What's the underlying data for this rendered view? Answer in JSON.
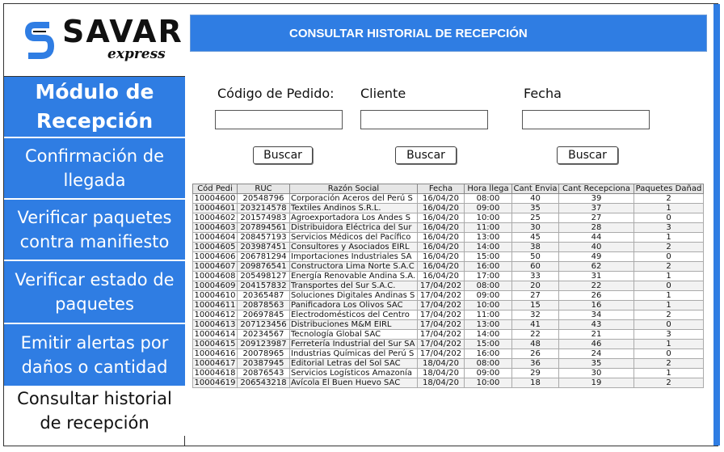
{
  "brand": {
    "name": "SAVAR",
    "tagline": "express",
    "primary_color": "#2f7de3",
    "logo_icon": "savar-s-logo-icon"
  },
  "sidebar": {
    "title": "Módulo de Recepción",
    "items": [
      {
        "label": "Confirmación de llegada"
      },
      {
        "label": "Verificar paquetes contra manifiesto"
      },
      {
        "label": "Verificar estado de paquetes"
      },
      {
        "label": "Emitir alertas por daños o cantidad"
      },
      {
        "label": "Consultar historial de recepción",
        "active": true
      }
    ]
  },
  "header": {
    "title": "CONSULTAR HISTORIAL DE RECEPCIÓN"
  },
  "filters": {
    "codigo_label": "Código de Pedido:",
    "cliente_label": "Cliente",
    "fecha_label": "Fecha",
    "codigo_value": "",
    "cliente_value": "",
    "fecha_value": "",
    "button_label": "Buscar"
  },
  "table": {
    "columns": [
      "Cód Pedi",
      "RUC",
      "Razón Social",
      "Fecha",
      "Hora llega",
      "Cant Envia",
      "Cant Recepciona",
      "Paquetes Dañad"
    ],
    "rows": [
      [
        "10004600",
        "20548796",
        "Corporación Aceros del Perú S",
        "16/04/20",
        "08:00",
        "40",
        "39",
        "2"
      ],
      [
        "10004601",
        "203214578",
        "Textiles Andinos S.R.L.",
        "16/04/20",
        "09:00",
        "35",
        "37",
        "1"
      ],
      [
        "10004602",
        "201574983",
        "Agroexportadora Los Andes S",
        "16/04/20",
        "10:00",
        "25",
        "27",
        "0"
      ],
      [
        "10004603",
        "207894561",
        "Distribuidora Eléctrica del Sur",
        "16/04/20",
        "11:00",
        "30",
        "28",
        "3"
      ],
      [
        "10004604",
        "208457193",
        "Servicios Médicos del Pacífico",
        "16/04/20",
        "13:00",
        "45",
        "44",
        "1"
      ],
      [
        "10004605",
        "203987451",
        "Consultores y Asociados EIRL",
        "16/04/20",
        "14:00",
        "38",
        "40",
        "2"
      ],
      [
        "10004606",
        "206781294",
        "Importaciones Industriales SA",
        "16/04/20",
        "15:00",
        "50",
        "49",
        "0"
      ],
      [
        "10004607",
        "209876541",
        "Constructora Lima Norte S.A.C",
        "16/04/20",
        "16:00",
        "60",
        "62",
        "2"
      ],
      [
        "10004608",
        "205498127",
        "Energía Renovable Andina S.A.",
        "16/04/20",
        "17:00",
        "33",
        "31",
        "1"
      ],
      [
        "10004609",
        "204157832",
        "Transportes del Sur S.A.C.",
        "17/04/202",
        "08:00",
        "20",
        "22",
        "0"
      ],
      [
        "10004610",
        "20365487",
        "Soluciones Digitales Andinas S",
        "17/04/202",
        "09:00",
        "27",
        "26",
        "1"
      ],
      [
        "10004611",
        "20878563",
        "Panificadora Los Olivos SAC",
        "17/04/202",
        "10:00",
        "15",
        "16",
        "1"
      ],
      [
        "10004612",
        "20697845",
        "Electrodomésticos del Centro",
        "17/04/202",
        "11:00",
        "32",
        "34",
        "2"
      ],
      [
        "10004613",
        "207123456",
        "Distribuciones M&M EIRL",
        "17/04/202",
        "13:00",
        "41",
        "43",
        "0"
      ],
      [
        "10004614",
        "20234567",
        "Tecnología Global SAC",
        "17/04/202",
        "14:00",
        "22",
        "21",
        "3"
      ],
      [
        "10004615",
        "209123987",
        "Ferretería Industrial del Sur SA",
        "17/04/202",
        "15:00",
        "48",
        "46",
        "1"
      ],
      [
        "10004616",
        "20078965",
        "Industrias Químicas del Perú S",
        "17/04/202",
        "16:00",
        "26",
        "24",
        "0"
      ],
      [
        "10004617",
        "20387945",
        "Editorial Letras del Sol SAC",
        "18/04/20",
        "08:00",
        "36",
        "35",
        "2"
      ],
      [
        "10004618",
        "20876543",
        "Servicios Logísticos Amazonía",
        "18/04/20",
        "09:00",
        "29",
        "30",
        "1"
      ],
      [
        "10004619",
        "206543218",
        "Avícola El Buen Huevo SAC",
        "18/04/20",
        "10:00",
        "18",
        "19",
        "2"
      ]
    ]
  }
}
